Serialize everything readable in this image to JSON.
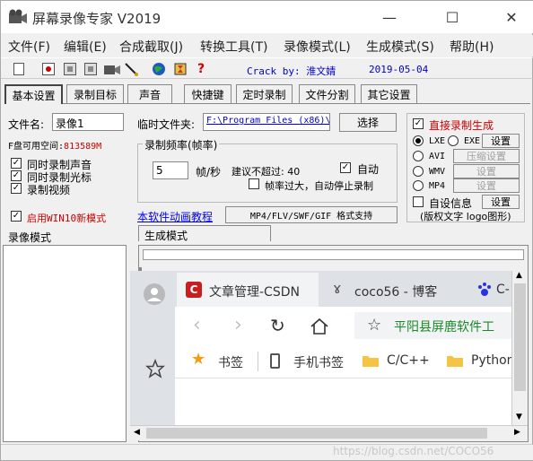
{
  "window": {
    "title": "屏幕录像专家 V2019",
    "minimize": "—",
    "maximize": "☐",
    "close": "✕"
  },
  "menu": [
    "文件(F)",
    "编辑(E)",
    "合成截取(J)",
    "转换工具(T)",
    "录像模式(L)",
    "生成模式(S)",
    "帮助(H)"
  ],
  "toolbar": {
    "crack_by": "Crack by: 淮文婧",
    "date": "2019-05-04",
    "icons": [
      "new-file-icon",
      "record-icon",
      "stop-icon",
      "pause-icon",
      "camera-icon",
      "pen-icon",
      "globe-icon",
      "hourglass-icon",
      "help-icon"
    ]
  },
  "tabs": [
    "基本设置",
    "录制目标",
    "声音",
    "快捷键",
    "定时录制",
    "文件分割",
    "其它设置"
  ],
  "basic": {
    "filename_label": "文件名:",
    "filename_value": "录像1",
    "tempdir_label": "临时文件夹:",
    "tempdir_value": "F:\\Program Files (x86)\\",
    "select_button": "选择",
    "disk_label": "F盘可用空间:",
    "disk_value": "813589M",
    "check_audio": "同时录制声音",
    "check_cursor": "同时录制光标",
    "check_video": "录制视频",
    "win10_label": "启用WIN10新模式",
    "fps_group": "录制频率(帧率)",
    "fps_value": "5",
    "fps_unit": "帧/秒",
    "fps_suggest": "建议不超过: 40",
    "auto_label": "自动",
    "fps_stop_label": "帧率过大，自动停止录制",
    "tutorial_link": "本软件动画教程",
    "formats_button": "MP4/FLV/SWF/GIF 格式支持",
    "direct_label": "直接录制生成",
    "fmt_lxe": "LXE",
    "fmt_exe": "EXE",
    "settings_btn": "设置",
    "fmt_avi": "AVI",
    "compress_btn": "压缩设置",
    "fmt_wmv": "WMV",
    "wmv_settings": "设置",
    "fmt_mp4": "MP4",
    "mp4_settings": "设置",
    "custom_info": "自设信息",
    "custom_settings": "设置",
    "copyright_note": "(版权文字 logo图形)"
  },
  "bottom": {
    "left_header": "录像模式",
    "right_header": "生成模式"
  },
  "browser": {
    "tabs": [
      "文章管理-CSDN",
      "coco56 - 博客",
      "C-"
    ],
    "address": "平阳县屏鹿软件工",
    "bookmarks": [
      "书签",
      "手机书签",
      "C/C++",
      "Python"
    ]
  },
  "watermark": "https://blog.csdn.net/COCO56",
  "colors": {
    "red": "#cc0000",
    "blue": "#0000cc",
    "link": "#0000ee"
  }
}
